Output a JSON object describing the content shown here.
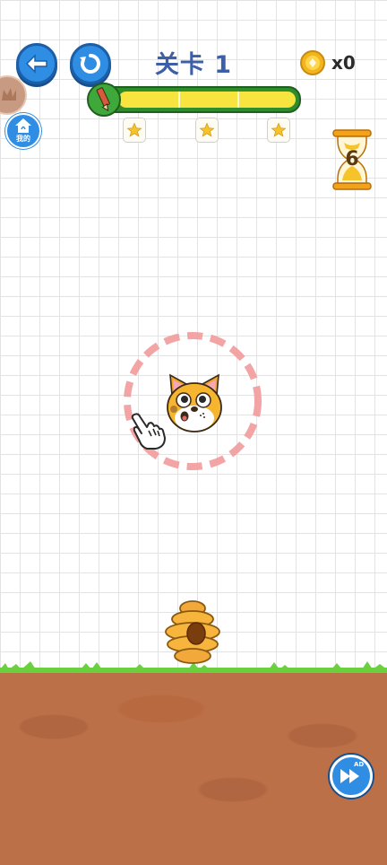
{
  "header": {
    "level_title": "关卡 1",
    "coin_count": "x0",
    "back_icon": "arrow-left-icon",
    "restart_icon": "refresh-icon",
    "coin_icon": "coin-icon"
  },
  "progress": {
    "pencil_icon": "pencil-icon",
    "ink_remaining": 1.0,
    "stars": [
      {
        "icon": "star-icon"
      },
      {
        "icon": "star-icon"
      },
      {
        "icon": "star-icon"
      }
    ]
  },
  "side": {
    "share_label": "我的"
  },
  "timer": {
    "seconds": "6",
    "icon": "hourglass-icon"
  },
  "scene": {
    "character": "dog-face",
    "hint": "hand-pointer-icon",
    "hazard": "beehive"
  },
  "controls": {
    "skip_icon": "fast-forward-icon",
    "skip_badge": "AD"
  },
  "colors": {
    "primary_blue": "#2f8de4",
    "progress_green": "#2e8d2b",
    "progress_yellow": "#f7e43e",
    "ground": "#bc7048",
    "grass": "#6bd03d",
    "dash_ring": "#f29a9a"
  }
}
